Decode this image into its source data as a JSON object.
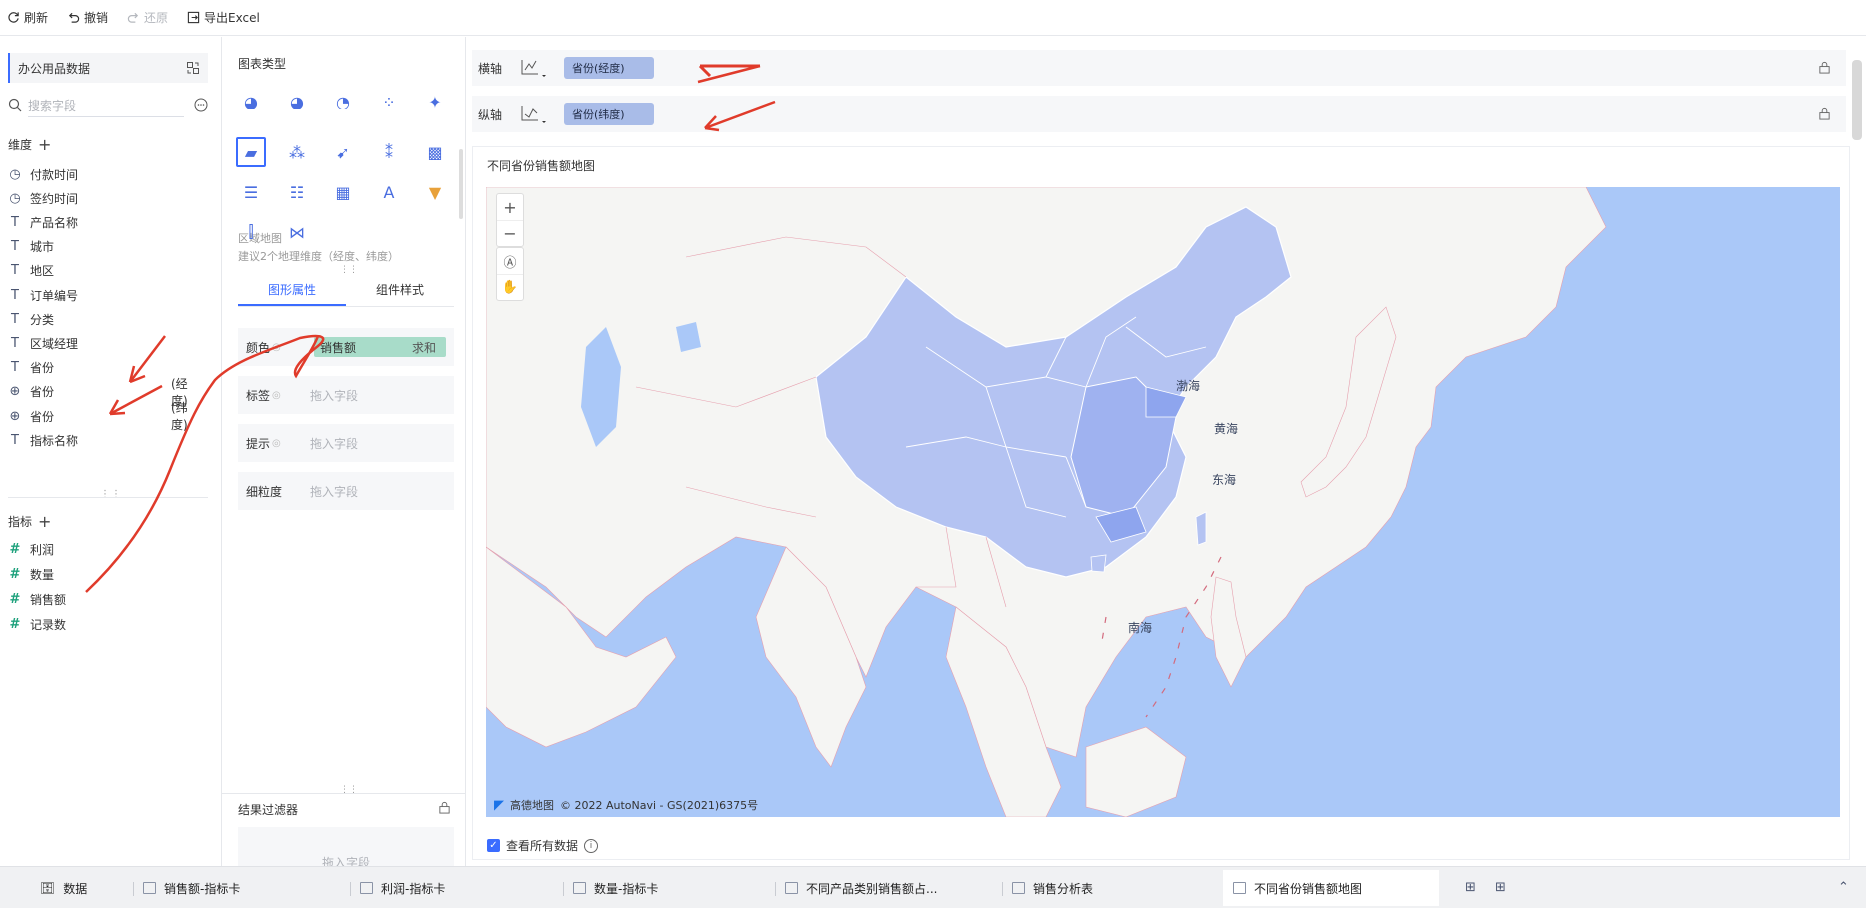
{
  "toolbar": {
    "refresh": "刷新",
    "undo": "撤销",
    "redo": "还原",
    "export": "导出Excel"
  },
  "left": {
    "dataset": "办公用品数据",
    "search_placeholder": "搜索字段",
    "dimensions_title": "维度",
    "dimensions": [
      {
        "icon": "clock-icon",
        "label": "付款时间"
      },
      {
        "icon": "clock-icon",
        "label": "签约时间"
      },
      {
        "icon": "text-type-icon",
        "label": "产品名称"
      },
      {
        "icon": "text-type-icon",
        "label": "城市"
      },
      {
        "icon": "text-type-icon",
        "label": "地区"
      },
      {
        "icon": "text-type-icon",
        "label": "订单编号"
      },
      {
        "icon": "text-type-icon",
        "label": "分类"
      },
      {
        "icon": "text-type-icon",
        "label": "区域经理"
      },
      {
        "icon": "text-type-icon",
        "label": "省份"
      },
      {
        "icon": "globe-icon",
        "label": "省份",
        "suffix": "(经度)"
      },
      {
        "icon": "globe-icon",
        "label": "省份",
        "suffix": "(纬度)"
      },
      {
        "icon": "text-type-icon",
        "label": "指标名称"
      }
    ],
    "measures_title": "指标",
    "measures": [
      {
        "icon": "number-icon",
        "label": "利润"
      },
      {
        "icon": "number-icon",
        "label": "数量"
      },
      {
        "icon": "number-icon",
        "label": "销售额"
      },
      {
        "icon": "number-icon",
        "label": "记录数"
      }
    ]
  },
  "middle": {
    "chart_type_title": "图表类型",
    "selected_chart_name": "区域地图",
    "selected_chart_hint": "建议2个地理维度（经度、纬度）",
    "tabs": [
      "图形属性",
      "组件样式"
    ],
    "props": {
      "color_label": "颜色",
      "color_field": "销售额",
      "color_agg": "求和",
      "label_label": "标签",
      "tooltip_label": "提示",
      "granularity_label": "细粒度",
      "drop_placeholder": "拖入字段"
    },
    "filter_title": "结果过滤器",
    "filter_placeholder": "拖入字段"
  },
  "axes": {
    "x_label": "横轴",
    "x_field": "省份(经度)",
    "y_label": "纵轴",
    "y_field": "省份(纬度)"
  },
  "chart": {
    "title": "不同省份销售额地图",
    "map_labels": {
      "bohai": "渤海",
      "huanghai": "黄海",
      "donghai": "东海",
      "nanhai": "南海"
    },
    "attribution_brand": "高德地图",
    "attribution": "© 2022 AutoNavi - GS(2021)6375号",
    "view_all": "查看所有数据",
    "colors": {
      "sea": "#aac8f8",
      "land": "#f5f5f3",
      "china": "#b4c3f2",
      "china_dark": "#8ea5ee"
    }
  },
  "bottom_tabs": [
    {
      "label": "数据",
      "active": false
    },
    {
      "label": "销售额-指标卡",
      "active": false
    },
    {
      "label": "利润-指标卡",
      "active": false
    },
    {
      "label": "数量-指标卡",
      "active": false
    },
    {
      "label": "不同产品类别销售额占...",
      "active": false
    },
    {
      "label": "销售分析表",
      "active": false
    },
    {
      "label": "不同省份销售额地图",
      "active": true
    }
  ]
}
